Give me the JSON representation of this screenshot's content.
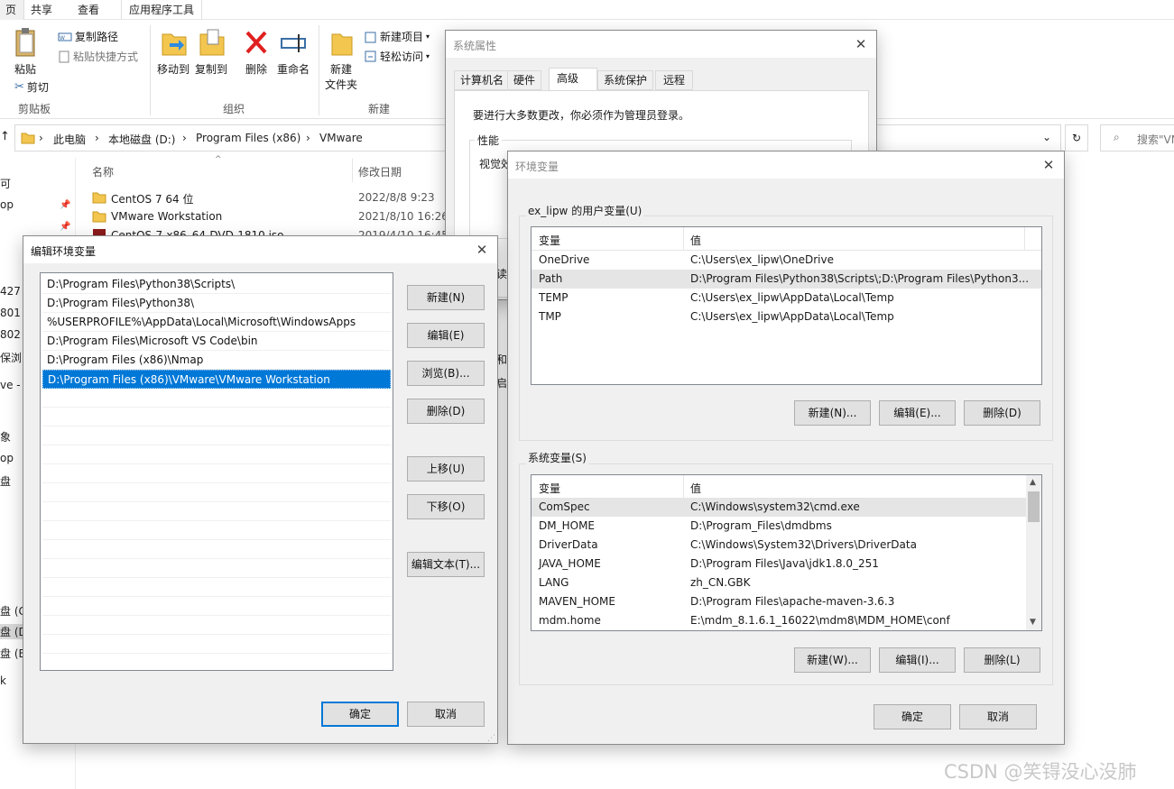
{
  "explorer": {
    "ribbon_tabs": [
      "页",
      "共享",
      "查看",
      "应用程序工具"
    ],
    "clipboard": {
      "paste": "粘贴",
      "copy_path": "复制路径",
      "paste_shortcut": "粘贴快捷方式",
      "cut": "剪切",
      "group": "剪贴板"
    },
    "organize": {
      "move_to": "移动到",
      "copy_to": "复制到",
      "delete": "删除",
      "rename": "重命名",
      "group": "组织"
    },
    "new": {
      "new_item": "新建项目",
      "easy_access": "轻松访问",
      "new_folder_1": "新建",
      "new_folder_2": "文件夹",
      "group": "新建"
    },
    "breadcrumb": [
      "此电脑",
      "本地磁盘 (D:)",
      "Program Files (x86)",
      "VMware"
    ],
    "search_placeholder": "搜索\"VM",
    "columns": {
      "name": "名称",
      "date": "修改日期"
    },
    "files": [
      {
        "name": "CentOS 7 64 位",
        "date": "2022/8/8 9:23",
        "kind": "folder"
      },
      {
        "name": "VMware Workstation",
        "date": "2021/8/10 16:26",
        "kind": "folder"
      },
      {
        "name": "CentOS-7-x86_64-DVD-1810.iso",
        "date": "2019/4/10 16:45",
        "kind": "iso"
      }
    ],
    "nav_fragments": [
      "可",
      "op",
      "427",
      "801",
      "802",
      "保浏",
      "ve - I",
      "象",
      "op",
      "盘",
      "盘 (C",
      "盘 (D",
      "盘 (E",
      "k"
    ]
  },
  "system_properties": {
    "title": "系统属性",
    "tabs": [
      "计算机名",
      "硬件",
      "高级",
      "系统保护",
      "远程"
    ],
    "active_tab": "高级",
    "admin_note": "要进行大多数更改，你必须作为管理员登录。",
    "perf_group": "性能",
    "perf_text": "视觉效",
    "fragments": [
      "读",
      "和",
      "启"
    ]
  },
  "env_vars": {
    "title": "环境变量",
    "user_group": "ex_lipw 的用户变量(U)",
    "col_var": "变量",
    "col_val": "值",
    "user_vars": [
      {
        "name": "OneDrive",
        "value": "C:\\Users\\ex_lipw\\OneDrive"
      },
      {
        "name": "Path",
        "value": "D:\\Program Files\\Python38\\Scripts\\;D:\\Program Files\\Python3..."
      },
      {
        "name": "TEMP",
        "value": "C:\\Users\\ex_lipw\\AppData\\Local\\Temp"
      },
      {
        "name": "TMP",
        "value": "C:\\Users\\ex_lipw\\AppData\\Local\\Temp"
      }
    ],
    "user_buttons": {
      "new": "新建(N)...",
      "edit": "编辑(E)...",
      "delete": "删除(D)"
    },
    "system_group": "系统变量(S)",
    "system_vars": [
      {
        "name": "ComSpec",
        "value": "C:\\Windows\\system32\\cmd.exe"
      },
      {
        "name": "DM_HOME",
        "value": "D:\\Program_Files\\dmdbms"
      },
      {
        "name": "DriverData",
        "value": "C:\\Windows\\System32\\Drivers\\DriverData"
      },
      {
        "name": "JAVA_HOME",
        "value": "D:\\Program Files\\Java\\jdk1.8.0_251"
      },
      {
        "name": "LANG",
        "value": "zh_CN.GBK"
      },
      {
        "name": "MAVEN_HOME",
        "value": "D:\\Program Files\\apache-maven-3.6.3"
      },
      {
        "name": "mdm.home",
        "value": "E:\\mdm_8.1.6.1_16022\\mdm8\\MDM_HOME\\conf"
      }
    ],
    "system_buttons": {
      "new": "新建(W)...",
      "edit": "编辑(I)...",
      "delete": "删除(L)"
    },
    "ok": "确定",
    "cancel": "取消"
  },
  "edit_env": {
    "title": "编辑环境变量",
    "entries": [
      "D:\\Program Files\\Python38\\Scripts\\",
      "D:\\Program Files\\Python38\\",
      "%USERPROFILE%\\AppData\\Local\\Microsoft\\WindowsApps",
      "D:\\Program Files\\Microsoft VS Code\\bin",
      "D:\\Program Files (x86)\\Nmap",
      "D:\\Program Files (x86)\\VMware\\VMware Workstation"
    ],
    "selected_index": 5,
    "buttons": {
      "new": "新建(N)",
      "edit": "编辑(E)",
      "browse": "浏览(B)...",
      "delete": "删除(D)",
      "up": "上移(U)",
      "down": "下移(O)",
      "edit_text": "编辑文本(T)..."
    },
    "ok": "确定",
    "cancel": "取消"
  },
  "watermark": "CSDN @笑锝没心没肺"
}
